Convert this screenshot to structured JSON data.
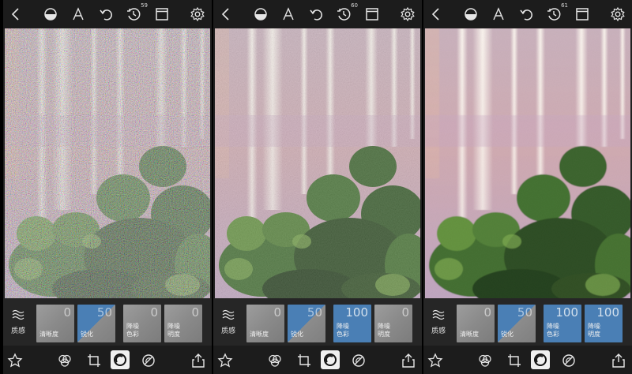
{
  "screens": [
    {
      "history_count": "59",
      "adjust_group_label": "质感",
      "tiles": [
        {
          "value": "0",
          "label": "清晰度",
          "style": "gray"
        },
        {
          "value": "50",
          "label": "锐化",
          "style": "split"
        },
        {
          "value": "0",
          "label": "降噪\n色彩",
          "style": "gray"
        },
        {
          "value": "0",
          "label": "降噪\n明度",
          "style": "gray"
        }
      ],
      "noise_level": 1.0
    },
    {
      "history_count": "60",
      "adjust_group_label": "质感",
      "tiles": [
        {
          "value": "0",
          "label": "清晰度",
          "style": "gray"
        },
        {
          "value": "50",
          "label": "锐化",
          "style": "split"
        },
        {
          "value": "100",
          "label": "降噪\n色彩",
          "style": "blue"
        },
        {
          "value": "0",
          "label": "降噪\n明度",
          "style": "gray"
        }
      ],
      "noise_level": 0.55
    },
    {
      "history_count": "61",
      "adjust_group_label": "质感",
      "tiles": [
        {
          "value": "0",
          "label": "清晰度",
          "style": "gray"
        },
        {
          "value": "50",
          "label": "锐化",
          "style": "split"
        },
        {
          "value": "100",
          "label": "降噪\n色彩",
          "style": "blue"
        },
        {
          "value": "100",
          "label": "降噪\n明度",
          "style": "blue"
        }
      ],
      "noise_level": 0.1
    }
  ],
  "icons": {
    "top": [
      "back-icon",
      "tone-icon",
      "text-icon",
      "undo-icon",
      "history-icon",
      "frame-icon",
      "settings-icon"
    ],
    "bottom": [
      "favorite-icon",
      "color-icon",
      "crop-icon",
      "lens-icon",
      "detail-icon",
      "share-icon"
    ]
  },
  "colors": {
    "accent_blue": "#4a7fb5",
    "toolbar_bg": "#1c1c1c",
    "adjust_bar_bg": "#262626"
  }
}
